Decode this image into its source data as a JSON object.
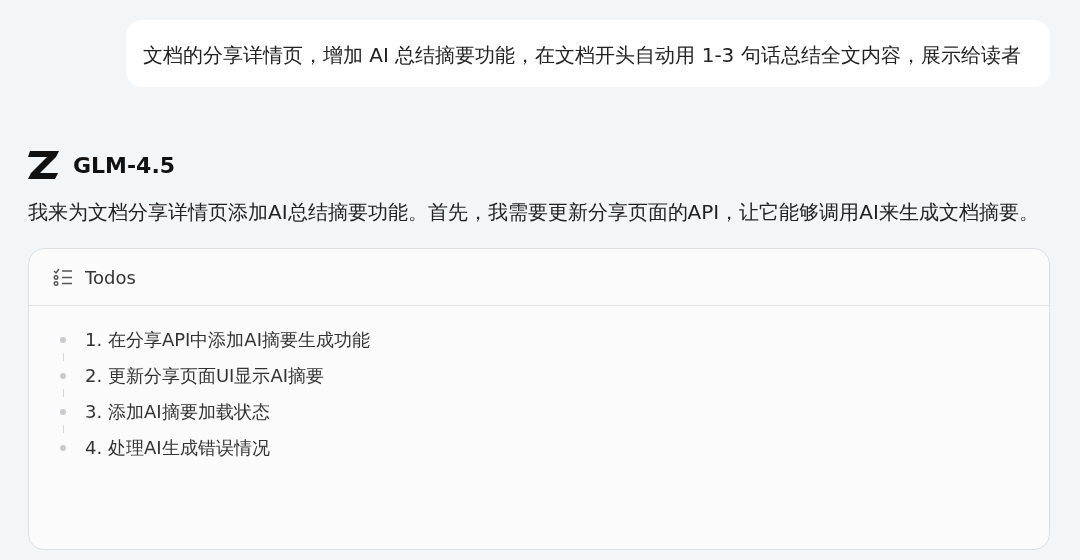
{
  "user_message": {
    "text": "文档的分享详情页，增加 AI 总结摘要功能，在文档开头自动用 1-3 句话总结全文内容，展示给读者"
  },
  "assistant": {
    "model_name": "GLM-4.5",
    "message": "我来为文档分享详情页添加AI总结摘要功能。首先，我需要更新分享页面的API，让它能够调用AI来生成文档摘要。"
  },
  "todos": {
    "title": "Todos",
    "items": [
      {
        "text": "1. 在分享API中添加AI摘要生成功能"
      },
      {
        "text": "2. 更新分享页面UI显示AI摘要"
      },
      {
        "text": "3. 添加AI摘要加载状态"
      },
      {
        "text": "4. 处理AI生成错误情况"
      }
    ]
  }
}
